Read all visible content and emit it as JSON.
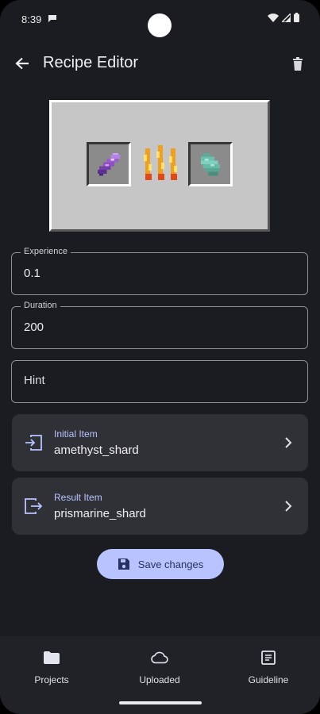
{
  "status_bar": {
    "time": "8:39"
  },
  "app_bar": {
    "title": "Recipe Editor"
  },
  "fields": {
    "experience": {
      "label": "Experience",
      "value": "0.1"
    },
    "duration": {
      "label": "Duration",
      "value": "200"
    },
    "hint": {
      "placeholder": "Hint",
      "value": ""
    }
  },
  "cards": {
    "initial": {
      "label": "Initial Item",
      "value": "amethyst_shard"
    },
    "result": {
      "label": "Result Item",
      "value": "prismarine_shard"
    }
  },
  "save_button": {
    "label": "Save changes"
  },
  "bottom_nav": {
    "items": [
      {
        "label": "Projects",
        "icon": "folder-icon"
      },
      {
        "label": "Uploaded",
        "icon": "cloud-icon"
      },
      {
        "label": "Guideline",
        "icon": "document-icon"
      }
    ]
  },
  "colors": {
    "background": "#1b1c21",
    "card": "#303137",
    "accent": "#b9c3ff",
    "nav": "#212228"
  }
}
